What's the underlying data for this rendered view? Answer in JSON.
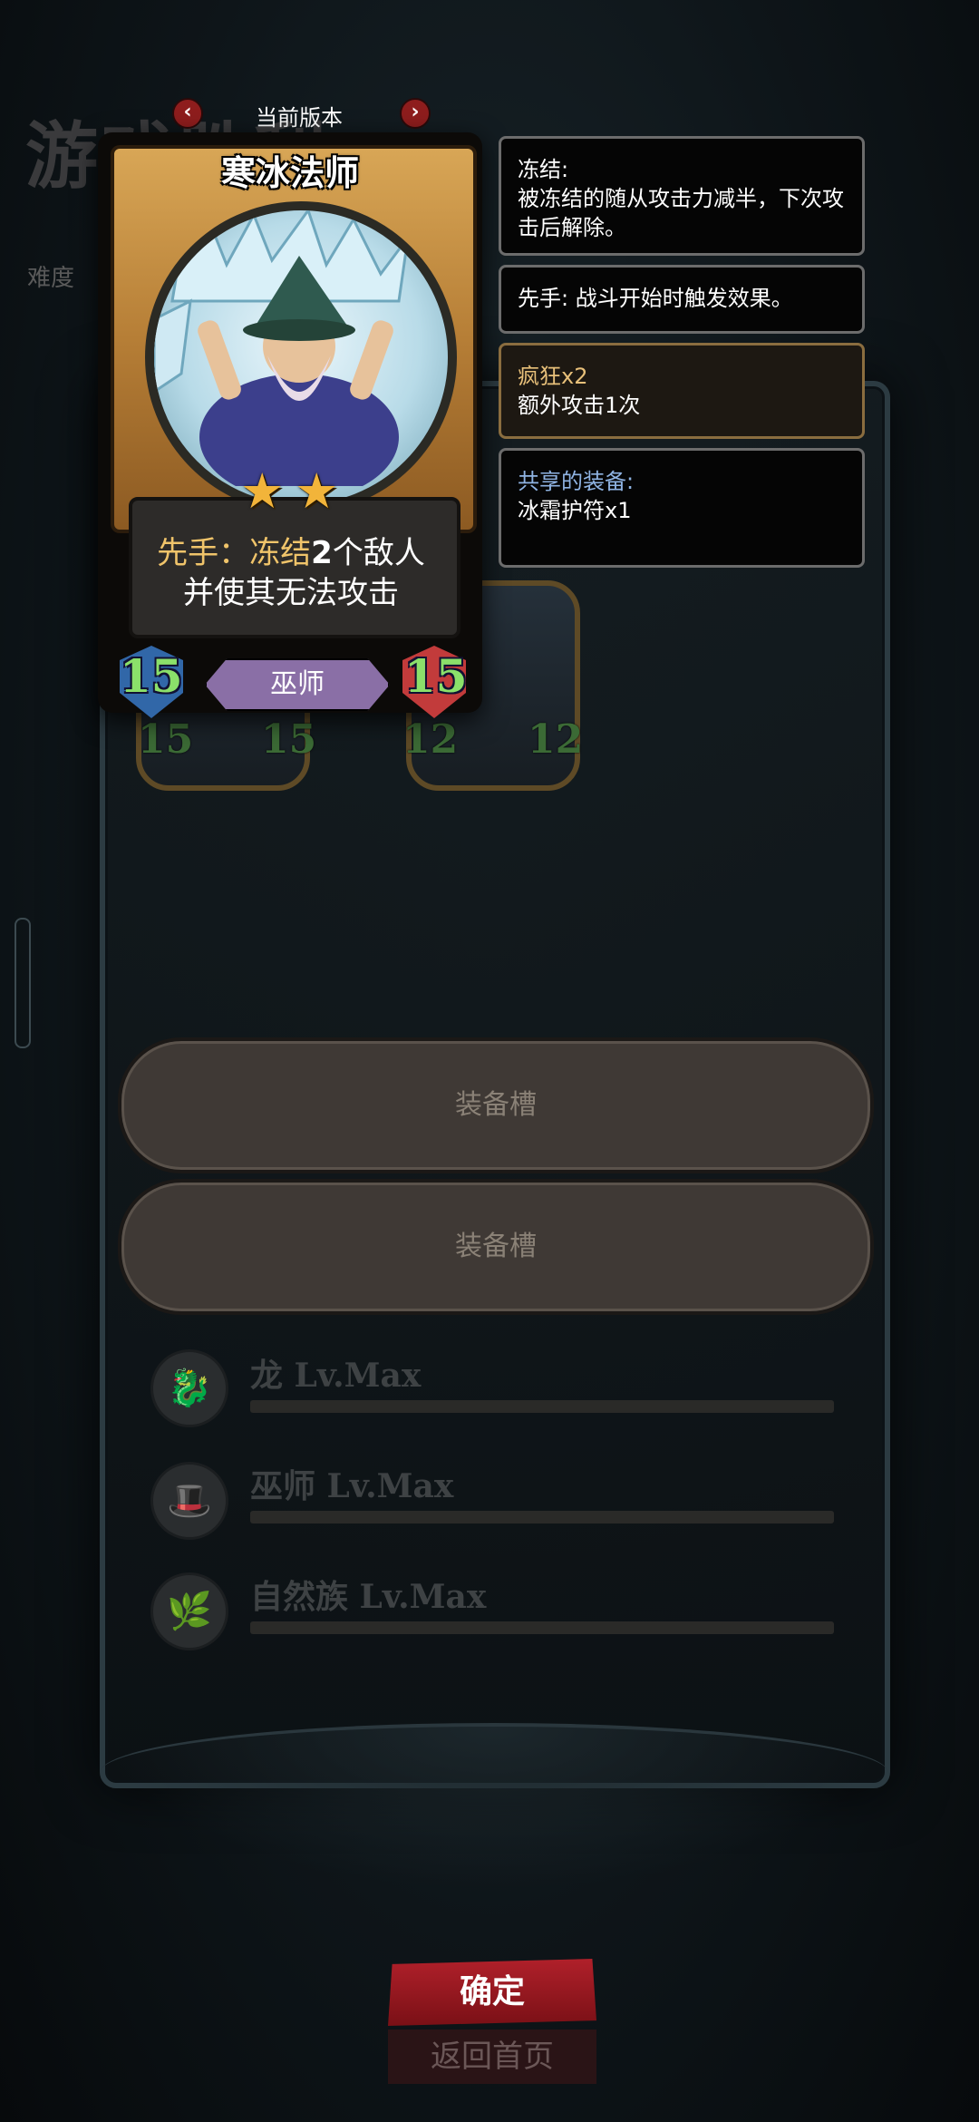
{
  "background": {
    "title": "游戏胜利",
    "difficulty_label": "难度"
  },
  "version": {
    "label": "当前版本",
    "prev_icon": "chevron-left-icon",
    "next_icon": "chevron-right-icon"
  },
  "card": {
    "name": "寒冰法师",
    "stars": 2,
    "description_prefix": "先手：",
    "description_keyword": "冻结",
    "description_highlight": "2",
    "description_rest": "个敌人",
    "description_line2": "并使其无法攻击",
    "attack": "15",
    "health": "15",
    "tribe": "巫师"
  },
  "tooltips": [
    {
      "title": "冻结:",
      "body": "被冻结的随从攻击力减半，下次攻击后解除。"
    },
    {
      "title": "",
      "body": "先手: 战斗开始时触发效果。"
    },
    {
      "title": "疯狂x2",
      "body": "额外攻击1次"
    },
    {
      "title": "共享的装备:",
      "body": "冰霜护符x1"
    }
  ],
  "tokens": [
    {
      "attack": "15",
      "health": "15"
    },
    {
      "attack": "12",
      "health": "12"
    }
  ],
  "slots": [
    "装备槽",
    "装备槽"
  ],
  "synergies": [
    {
      "name": "龙 Lv.Max",
      "icon": "dragon-icon",
      "level": 1.0
    },
    {
      "name": "巫师 Lv.Max",
      "icon": "wizard-hat-icon",
      "level": 1.0
    },
    {
      "name": "自然族 Lv.Max",
      "icon": "nature-icon",
      "level": 1.0
    }
  ],
  "buttons": {
    "confirm": "确定",
    "home": "返回首页"
  }
}
